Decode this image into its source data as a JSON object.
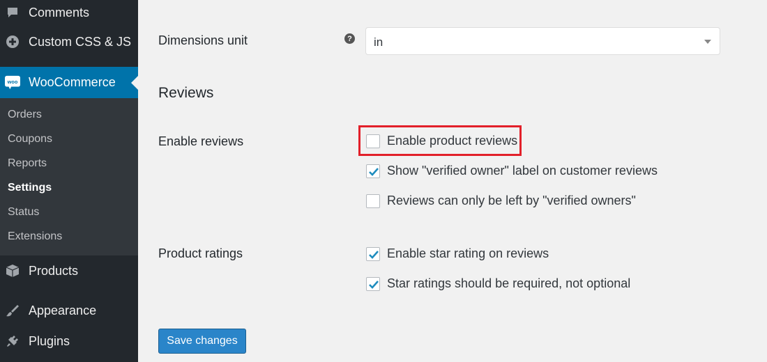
{
  "sidebar": {
    "top_items": [
      {
        "label": "Comments",
        "icon": "comment-bubble-icon"
      },
      {
        "label": "Custom CSS & JS",
        "icon": "plus-circle-icon"
      },
      {
        "label": "WooCommerce",
        "icon": "woo-logo-icon",
        "active": true
      }
    ],
    "woo_logo_text": "woo",
    "submenu": [
      {
        "label": "Orders"
      },
      {
        "label": "Coupons"
      },
      {
        "label": "Reports"
      },
      {
        "label": "Settings",
        "current": true
      },
      {
        "label": "Status"
      },
      {
        "label": "Extensions"
      }
    ],
    "bottom_items": [
      {
        "label": "Products",
        "icon": "box-icon"
      },
      {
        "label": "Appearance",
        "icon": "paintbrush-icon"
      },
      {
        "label": "Plugins",
        "icon": "plug-icon"
      }
    ]
  },
  "main": {
    "dimensions_unit": {
      "label": "Dimensions unit",
      "help": "?",
      "value": "in"
    },
    "reviews_section_title": "Reviews",
    "enable_reviews": {
      "label": "Enable reviews",
      "options": [
        {
          "text": "Enable product reviews",
          "checked": false
        },
        {
          "text": "Show \"verified owner\" label on customer reviews",
          "checked": true
        },
        {
          "text": "Reviews can only be left by \"verified owners\"",
          "checked": false
        }
      ]
    },
    "product_ratings": {
      "label": "Product ratings",
      "options": [
        {
          "text": "Enable star rating on reviews",
          "checked": true
        },
        {
          "text": "Star ratings should be required, not optional",
          "checked": true
        }
      ]
    },
    "save_label": "Save changes"
  },
  "colors": {
    "sidebar_bg": "#23282d",
    "active_menu": "#0073aa",
    "highlight_border": "#e2202a",
    "button_bg": "#2a85c9",
    "check_mark": "#1e8cbe"
  }
}
